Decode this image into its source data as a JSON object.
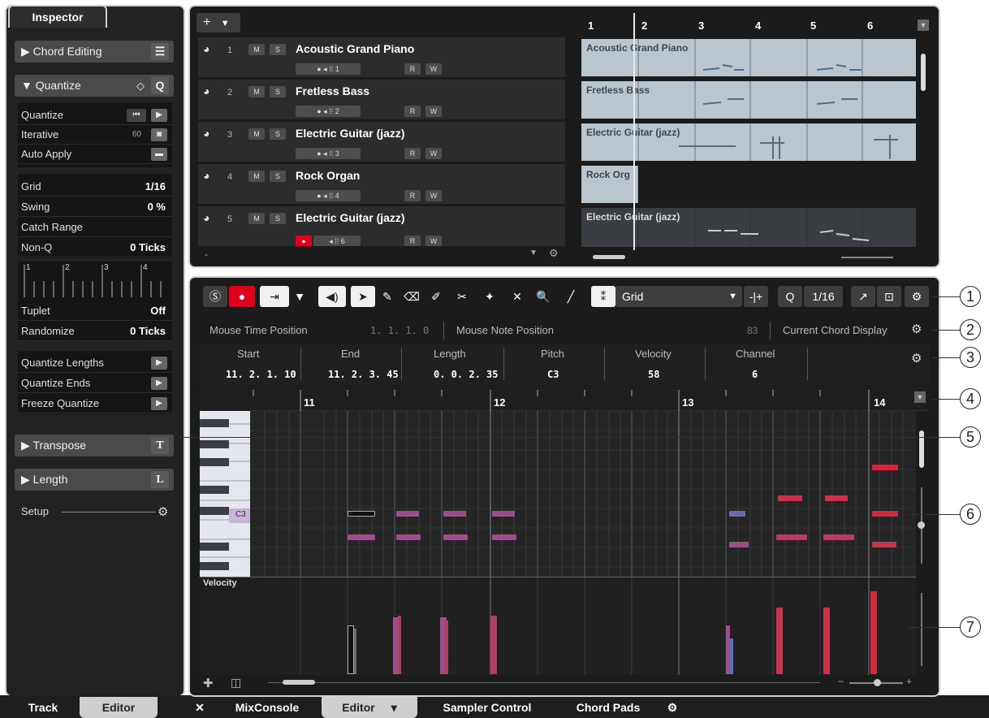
{
  "inspector": {
    "tab": "Inspector",
    "chord_editing": "Chord Editing",
    "quantize_header": "Quantize",
    "quantize_icon": "Q",
    "quantize_rows": [
      {
        "label": "Quantize",
        "value": ""
      },
      {
        "label": "Iterative",
        "value": "60"
      },
      {
        "label": "Auto Apply",
        "value": ""
      }
    ],
    "grid_rows": [
      {
        "label": "Grid",
        "value": "1/16"
      },
      {
        "label": "Swing",
        "value": "0 %"
      },
      {
        "label": "Catch Range",
        "value": ""
      },
      {
        "label": "Non-Q",
        "value": "0 Ticks"
      }
    ],
    "groove_ticks": [
      "1",
      "2",
      "3",
      "4"
    ],
    "tuplet_rows": [
      {
        "label": "Tuplet",
        "value": "Off"
      },
      {
        "label": "Randomize",
        "value": "0 Ticks"
      }
    ],
    "bottom_rows": [
      {
        "label": "Quantize Lengths"
      },
      {
        "label": "Quantize Ends"
      },
      {
        "label": "Freeze Quantize"
      }
    ],
    "transpose": "Transpose",
    "transpose_icon": "T",
    "length": "Length",
    "length_icon": "L",
    "setup": "Setup"
  },
  "bottom_tabs": {
    "track": "Track",
    "editor": "Editor",
    "mixconsole": "MixConsole",
    "editor2": "Editor",
    "sampler": "Sampler Control",
    "chordpads": "Chord Pads"
  },
  "tracks": [
    {
      "num": "1",
      "name": "Acoustic Grand Piano",
      "ch": "1"
    },
    {
      "num": "2",
      "name": "Fretless Bass",
      "ch": "2"
    },
    {
      "num": "3",
      "name": "Electric Guitar (jazz)",
      "ch": "3"
    },
    {
      "num": "4",
      "name": "Rock Organ",
      "ch": "4"
    },
    {
      "num": "5",
      "name": "Electric Guitar (jazz)",
      "ch": "6"
    }
  ],
  "track_buttons": {
    "mute": "M",
    "solo": "S",
    "read": "R",
    "write": "W"
  },
  "events": [
    {
      "label": "Acoustic Grand Piano"
    },
    {
      "label": "Fretless Bass"
    },
    {
      "label": "Electric Guitar (jazz)"
    },
    {
      "label": "Rock Org"
    },
    {
      "label": "Electric Guitar (jazz)"
    }
  ],
  "project_ruler": [
    "1",
    "2",
    "3",
    "4",
    "5",
    "6"
  ],
  "editor": {
    "grid_label": "Grid",
    "quantize_value": "1/16",
    "q_icon": "Q",
    "mouse_time_label": "Mouse Time Position",
    "mouse_time_value": "1. 1. 1.  0",
    "mouse_note_label": "Mouse Note Position",
    "mouse_note_value": "83",
    "chord_display_label": "Current Chord Display",
    "info_headers": [
      "Start",
      "End",
      "Length",
      "Pitch",
      "Velocity",
      "Channel"
    ],
    "info_values": [
      "11. 2. 1. 10",
      "11. 2. 3. 45",
      "0. 0. 2. 35",
      "C3",
      "58",
      "6"
    ],
    "ruler": [
      "11",
      "12",
      "13",
      "14"
    ],
    "key_label": "C3",
    "velocity_label": "Velocity"
  },
  "callouts": [
    "1",
    "2",
    "3",
    "4",
    "5",
    "6",
    "7"
  ],
  "colors": {
    "record": "#e0001b",
    "note_purple": "#9b4f8a",
    "note_red": "#c8344c",
    "note_blue": "#6a6ab0"
  }
}
